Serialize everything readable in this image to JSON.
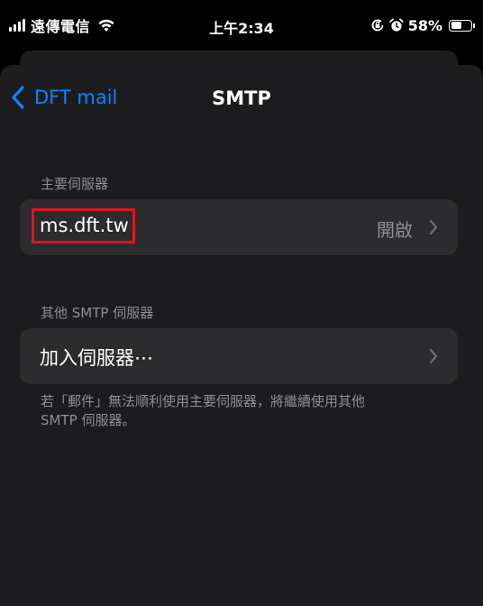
{
  "status_bar": {
    "carrier": "遠傳電信",
    "time": "上午2:34",
    "battery_percent": "58%",
    "battery_level": 0.58,
    "icons": [
      "cellular-signal-icon",
      "wifi-icon",
      "orientation-lock-icon",
      "alarm-icon",
      "battery-icon"
    ]
  },
  "nav": {
    "back_label": "DFT mail",
    "title": "SMTP"
  },
  "primary_section": {
    "header": "主要伺服器",
    "server_name": "ms.dft.tw",
    "server_status": "開啟"
  },
  "other_section": {
    "header": "其他 SMTP 伺服器",
    "add_server_label": "加入伺服器⋯",
    "footer_line1": "若「郵件」無法順利使用主要伺服器，將繼續使用其他",
    "footer_line2": "SMTP 伺服器。"
  },
  "colors": {
    "accent": "#0a84ff",
    "background": "#1c1c1e",
    "cell": "#2c2c2e",
    "secondary_text": "#8e8e93",
    "highlight": "#e0161f"
  }
}
